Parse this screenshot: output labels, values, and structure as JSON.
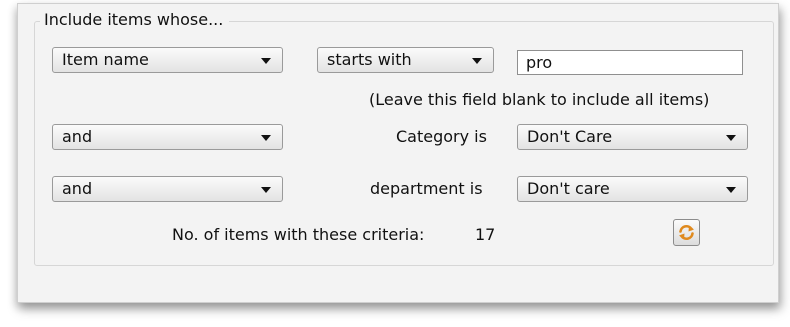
{
  "group": {
    "legend": "Include items whose..."
  },
  "row1": {
    "field_select": "Item name",
    "operator_select": "starts with",
    "value": "pro",
    "hint": "(Leave this field blank to include all items)"
  },
  "row2": {
    "conjunction": "and",
    "label": "Category is",
    "value_select": "Don't Care"
  },
  "row3": {
    "conjunction": "and",
    "label": "department is",
    "value_select": "Don't care"
  },
  "count": {
    "label": "No. of items with these criteria:",
    "value": "17"
  },
  "icons": {
    "dropdown_arrow": "chevron-down-icon",
    "refresh": "refresh-icon"
  },
  "colors": {
    "refresh_icon": "#e08a1e"
  }
}
